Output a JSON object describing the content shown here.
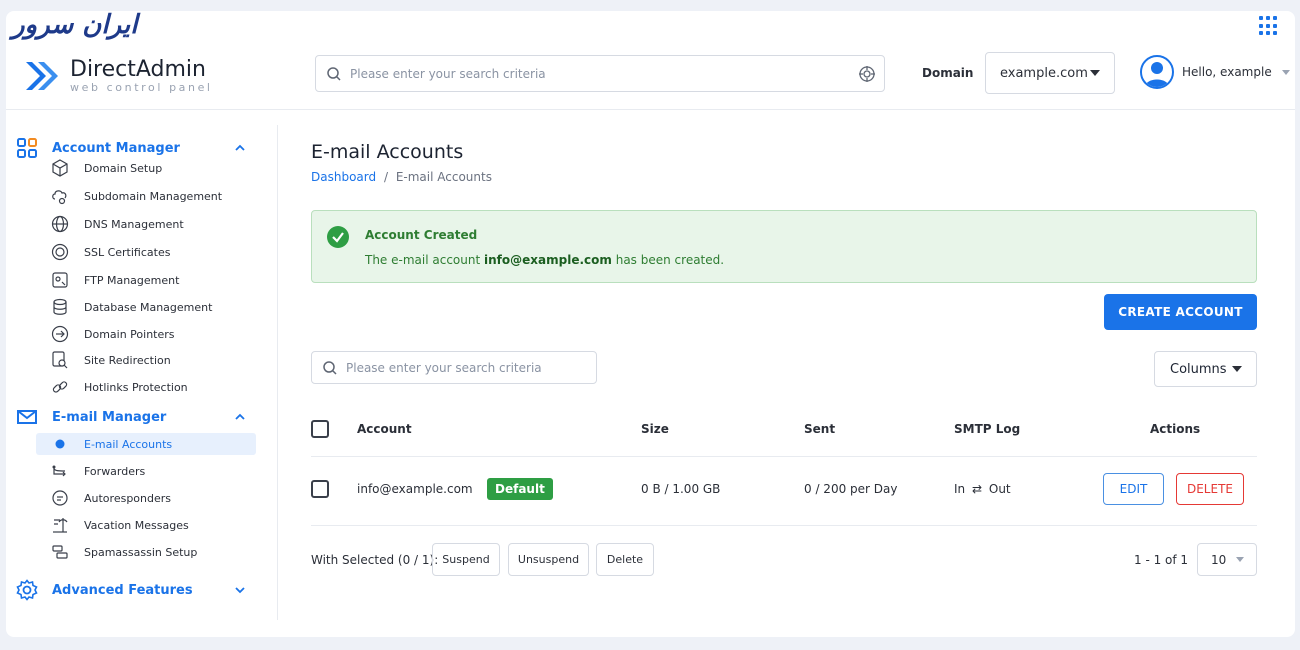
{
  "brand": {
    "logo_text": "ایران سرور"
  },
  "header": {
    "app_title": "DirectAdmin",
    "app_subtitle": "web control panel",
    "search_placeholder": "Please enter your search criteria",
    "domain_label": "Domain",
    "domain_value": "example.com",
    "user_greeting": "Hello, example"
  },
  "sidebar": {
    "account_manager": {
      "label": "Account Manager",
      "items": [
        {
          "label": "Domain Setup",
          "icon": "domain-setup-icon"
        },
        {
          "label": "Subdomain Management",
          "icon": "subdomain-icon"
        },
        {
          "label": "DNS Management",
          "icon": "globe-icon"
        },
        {
          "label": "SSL Certificates",
          "icon": "ssl-icon"
        },
        {
          "label": "FTP Management",
          "icon": "ftp-icon"
        },
        {
          "label": "Database Management",
          "icon": "database-icon"
        },
        {
          "label": "Domain Pointers",
          "icon": "pointer-icon"
        },
        {
          "label": "Site Redirection",
          "icon": "redirect-icon"
        },
        {
          "label": "Hotlinks Protection",
          "icon": "link-icon"
        }
      ]
    },
    "email_manager": {
      "label": "E-mail Manager",
      "items": [
        {
          "label": "E-mail Accounts",
          "icon": "dot-icon",
          "active": true
        },
        {
          "label": "Forwarders",
          "icon": "forward-icon"
        },
        {
          "label": "Autoresponders",
          "icon": "chat-icon"
        },
        {
          "label": "Vacation Messages",
          "icon": "vacation-icon"
        },
        {
          "label": "Spamassassin Setup",
          "icon": "spam-icon"
        }
      ]
    },
    "advanced_features": {
      "label": "Advanced Features"
    }
  },
  "main": {
    "title": "E-mail Accounts",
    "breadcrumb": {
      "home": "Dashboard",
      "separator": "/",
      "current": "E-mail Accounts"
    },
    "alert": {
      "title": "Account Created",
      "msg_prefix": "The e-mail account",
      "msg_email": "info@example.com",
      "msg_suffix": "has been created."
    },
    "create_button": "CREATE ACCOUNT",
    "table_search_placeholder": "Please enter your search criteria",
    "columns_button": "Columns",
    "table": {
      "headers": {
        "account": "Account",
        "size": "Size",
        "sent": "Sent",
        "smtp": "SMTP Log",
        "actions": "Actions"
      },
      "rows": [
        {
          "account": "info@example.com",
          "badge": "Default",
          "size": "0 B / 1.00 GB",
          "sent": "0 / 200 per Day",
          "smtp_in": "In",
          "smtp_arrow": "⇄",
          "smtp_out": "Out",
          "edit": "EDIT",
          "delete": "DELETE"
        }
      ]
    },
    "footer": {
      "with_selected": "With Selected (0 / 1):",
      "suspend": "Suspend",
      "unsuspend": "Unsuspend",
      "delete": "Delete",
      "pagination": "1 - 1 of 1",
      "per_page": "10"
    }
  },
  "colors": {
    "accent": "#1a73e8",
    "success": "#2e9e44",
    "danger": "#e53935"
  }
}
